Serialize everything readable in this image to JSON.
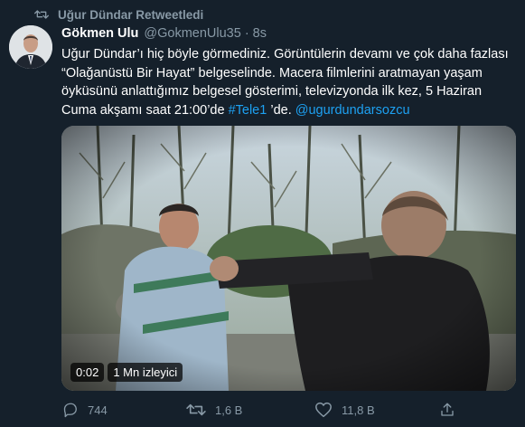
{
  "retweet": {
    "label": "Uğur Dündar Retweetledi"
  },
  "author": {
    "name": "Gökmen Ulu",
    "handle": "@GokmenUlu35",
    "separator": "·",
    "time": "8s"
  },
  "tweet": {
    "text_1": "Uğur Dündar’ı hiç böyle görmediniz. Görüntülerin devamı ve çok daha fazlası “Olağanüstü Bir Hayat” belgeselinde. Macera filmlerini aratmayan yaşam öyküsünü anlattığımız belgesel gösterimi, televizyonda ilk kez, 5 Haziran Cuma akşamı saat 21:00’de ",
    "hashtag": "#Tele1",
    "text_2": " ’de. ",
    "mention": "@ugurdundarsozcu"
  },
  "video": {
    "duration": "0:02",
    "views": "1 Mn izleyici"
  },
  "actions": {
    "replies": "744",
    "retweets": "1,6 B",
    "likes": "11,8 B"
  },
  "colors": {
    "background": "#15202b",
    "secondary_text": "#8899a6",
    "link": "#1da1f2"
  }
}
